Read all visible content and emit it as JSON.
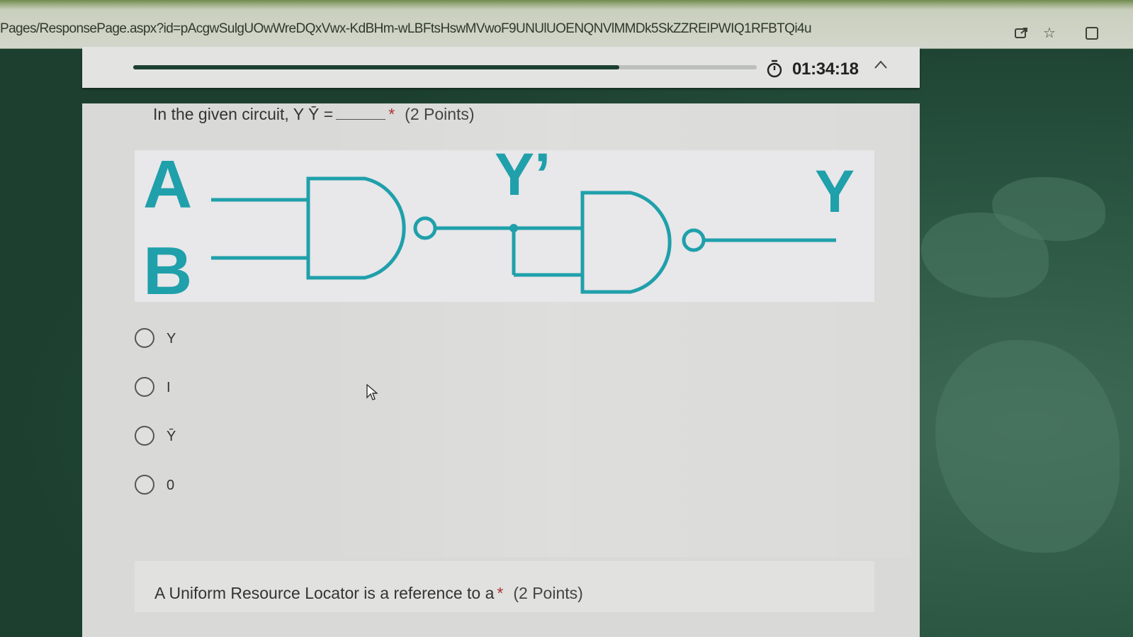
{
  "browser": {
    "url": "Pages/ResponsePage.aspx?id=pAcgwSulgUOwWreDQxVwx-KdBHm-wLBFtsHswMVwoF9UNUlUOENQNVlMMDk5SkZZREIPWIQ1RFBTQi4u",
    "icons": [
      "share-icon",
      "star-icon",
      "tab-icon"
    ]
  },
  "progress": {
    "fraction": 0.78,
    "timer": "01:34:18",
    "collapse_icon": "chevron-up-icon"
  },
  "question1": {
    "text": "In the given circuit, Y Ȳ =",
    "blank": "______",
    "required_mark": "*",
    "points": "(2 Points)",
    "circuit_labels": {
      "input_a": "A",
      "input_b": "B",
      "intermediate": "Y’",
      "output": "Y"
    },
    "options": [
      {
        "label": "Y"
      },
      {
        "label": "I"
      },
      {
        "label": "Ȳ"
      },
      {
        "label": "0"
      }
    ]
  },
  "question2": {
    "text": "A Uniform Resource Locator is a reference to a",
    "required_mark": "*",
    "points": "(2 Points)"
  },
  "colors": {
    "circuit": "#1fa0ab",
    "progress_fill": "#1c3f33",
    "required": "#a33333"
  }
}
